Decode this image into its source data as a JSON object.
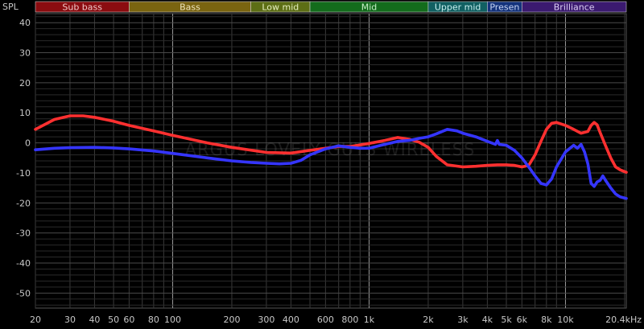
{
  "chart_data": {
    "type": "line",
    "ylabel": "SPL",
    "watermark": "ARGUS LOVELY GUYS WIRELESS",
    "x_scale": "log",
    "xlim": [
      20,
      20400
    ],
    "ylim": [
      -55,
      43
    ],
    "grid": true,
    "y_ticks": [
      40,
      30,
      20,
      10,
      0,
      -10,
      -20,
      -30,
      -40,
      -50
    ],
    "y_tick_labels": [
      "40",
      "30",
      "20",
      "10",
      "0",
      "-10",
      "-20",
      "-30",
      "-40",
      "-50"
    ],
    "x_ticks": [
      20,
      30,
      40,
      50,
      60,
      80,
      100,
      200,
      300,
      400,
      600,
      800,
      1000,
      2000,
      3000,
      4000,
      5000,
      6000,
      8000,
      10000,
      20400
    ],
    "x_tick_labels": [
      "20",
      "30",
      "40",
      "50",
      "60",
      "80",
      "100",
      "200",
      "300",
      "400",
      "600",
      "800",
      "1k",
      "2k",
      "3k",
      "4k",
      "5k",
      "6k",
      "8k",
      "10k",
      "20.4kHz"
    ],
    "bands": [
      {
        "label": "Sub bass",
        "from": 20,
        "to": 60,
        "color": "#8b0c10",
        "text_color": "#f0c8c8"
      },
      {
        "label": "Bass",
        "from": 60,
        "to": 250,
        "color": "#7a6410",
        "text_color": "#f0e6c0"
      },
      {
        "label": "Low mid",
        "from": 250,
        "to": 500,
        "color": "#5d6e15",
        "text_color": "#e6f0c0"
      },
      {
        "label": "Mid",
        "from": 500,
        "to": 2000,
        "color": "#136c1c",
        "text_color": "#c8f0c8"
      },
      {
        "label": "Upper mid",
        "from": 2000,
        "to": 4000,
        "color": "#116062",
        "text_color": "#c8f0f0"
      },
      {
        "label": "Presen",
        "from": 4000,
        "to": 6000,
        "color": "#14337c",
        "text_color": "#c8d6f5"
      },
      {
        "label": "Brilliance",
        "from": 6000,
        "to": 20400,
        "color": "#3b1a70",
        "text_color": "#ddd0f5"
      }
    ],
    "series": [
      {
        "color": "#ff3030",
        "x": [
          20,
          25,
          30,
          35,
          40,
          50,
          60,
          80,
          100,
          150,
          200,
          300,
          400,
          500,
          600,
          700,
          800,
          1000,
          1200,
          1400,
          1600,
          1800,
          2000,
          2200,
          2500,
          3000,
          3500,
          4000,
          4500,
          5000,
          5500,
          6000,
          6500,
          7000,
          7500,
          8000,
          8500,
          9000,
          10000,
          11000,
          12000,
          13000,
          13500,
          14000,
          14500,
          15000,
          16000,
          17000,
          18000,
          19000,
          20400
        ],
        "y": [
          4.5,
          7.8,
          9.0,
          9.0,
          8.5,
          7.2,
          5.8,
          4.0,
          2.5,
          0.0,
          -1.5,
          -3.2,
          -3.4,
          -2.5,
          -1.8,
          -1.2,
          -1.2,
          -0.2,
          0.8,
          1.8,
          1.2,
          0.2,
          -1.5,
          -4.5,
          -7.3,
          -8.0,
          -7.8,
          -7.5,
          -7.3,
          -7.3,
          -7.5,
          -8.0,
          -7.5,
          -4.0,
          0.5,
          4.5,
          6.5,
          6.8,
          5.8,
          4.5,
          3.2,
          3.8,
          5.8,
          6.8,
          6.0,
          3.5,
          -1.0,
          -5.0,
          -8.0,
          -9.0,
          -9.8
        ]
      },
      {
        "color": "#3535ff",
        "x": [
          20,
          25,
          30,
          40,
          50,
          60,
          80,
          100,
          150,
          200,
          250,
          300,
          350,
          400,
          450,
          500,
          600,
          700,
          800,
          900,
          1000,
          1200,
          1400,
          1600,
          1800,
          2000,
          2200,
          2500,
          2800,
          3000,
          3500,
          4000,
          4400,
          4500,
          4600,
          5000,
          5500,
          6000,
          6500,
          7000,
          7500,
          8000,
          8500,
          9000,
          10000,
          11000,
          11500,
          12000,
          12500,
          13000,
          13500,
          14000,
          14500,
          15000,
          15500,
          16000,
          17000,
          18000,
          19000,
          20400
        ],
        "y": [
          -2.3,
          -1.8,
          -1.6,
          -1.5,
          -1.7,
          -2.0,
          -2.7,
          -3.5,
          -5.0,
          -6.0,
          -6.5,
          -6.8,
          -7.0,
          -6.8,
          -5.8,
          -4.0,
          -2.0,
          -1.0,
          -1.5,
          -1.8,
          -1.8,
          -0.5,
          0.5,
          0.8,
          1.5,
          2.0,
          3.0,
          4.5,
          4.0,
          3.2,
          2.0,
          0.5,
          -0.5,
          0.8,
          -0.5,
          -0.8,
          -2.5,
          -5.0,
          -8.0,
          -11.0,
          -13.5,
          -14.0,
          -12.0,
          -8.0,
          -3.0,
          -0.8,
          -1.8,
          -0.5,
          -3.0,
          -7.0,
          -13.5,
          -14.5,
          -13.0,
          -12.5,
          -11.0,
          -12.5,
          -15.0,
          -17.0,
          -18.0,
          -18.5
        ]
      }
    ]
  }
}
